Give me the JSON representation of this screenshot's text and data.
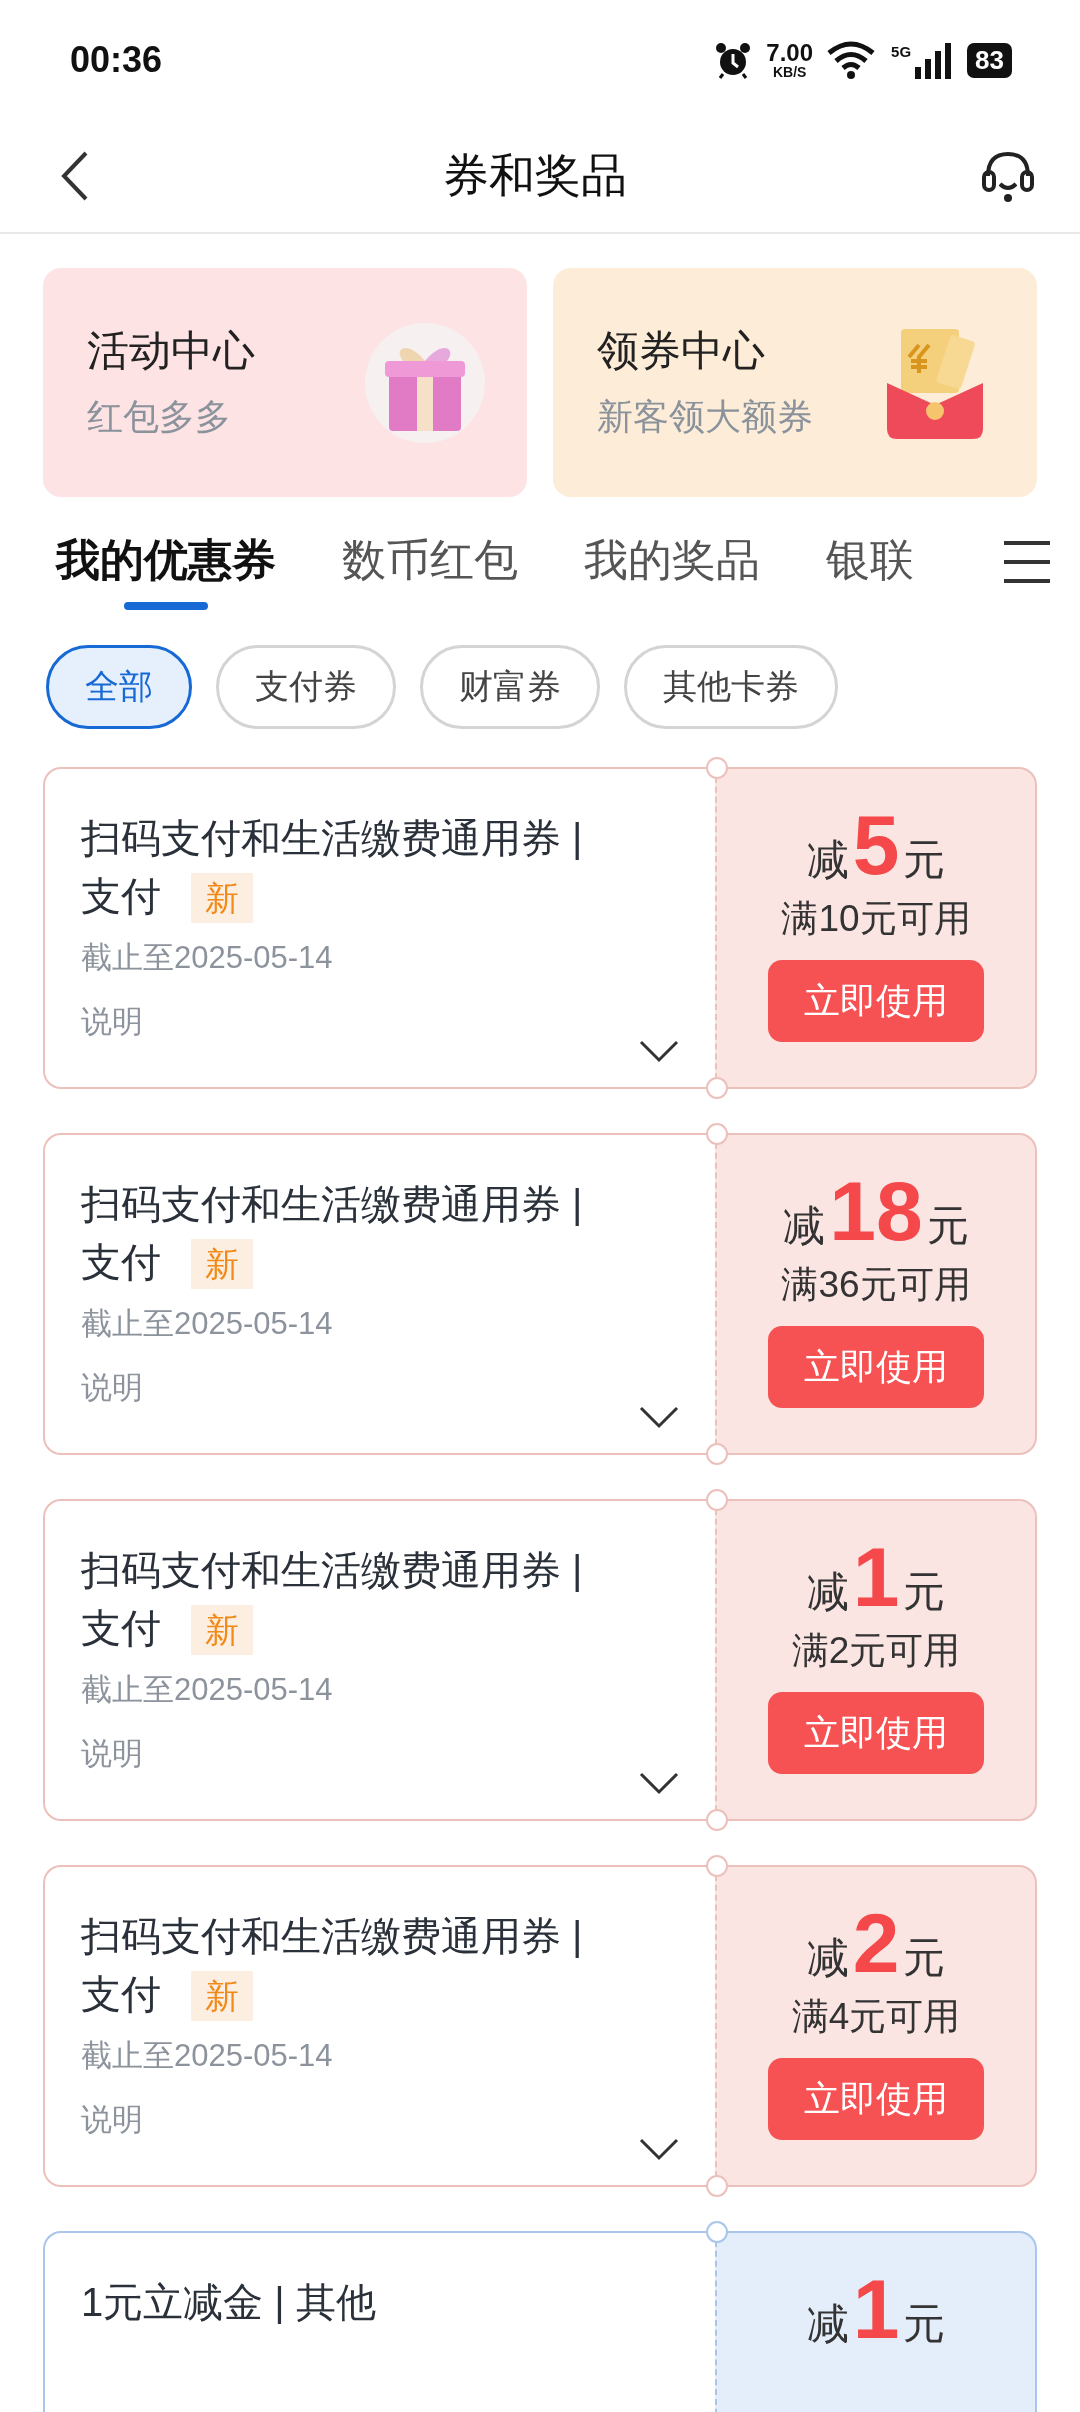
{
  "status_bar": {
    "time": "00:36",
    "speed": "7.00",
    "speed_unit": "KB/S",
    "network": "5G",
    "battery": "83"
  },
  "header": {
    "title": "券和奖品"
  },
  "promo_cards": [
    {
      "kind": "gift",
      "title": "活动中心",
      "subtitle": "红包多多"
    },
    {
      "kind": "envelope",
      "title": "领券中心",
      "subtitle": "新客领大额券"
    }
  ],
  "tabs": [
    {
      "label": "我的优惠券",
      "selected": true
    },
    {
      "label": "数币红包",
      "selected": false
    },
    {
      "label": "我的奖品",
      "selected": false
    },
    {
      "label": "银联",
      "selected": false
    }
  ],
  "filters": [
    {
      "label": "全部",
      "selected": true
    },
    {
      "label": "支付券",
      "selected": false
    },
    {
      "label": "财富券",
      "selected": false
    },
    {
      "label": "其他卡券",
      "selected": false
    }
  ],
  "coupons": [
    {
      "kind": "payment",
      "title": "扫码支付和生活缴费通用券 | 支付",
      "badge": "新",
      "deadline": "截止至2025-05-14",
      "note": "说明",
      "prefix": "减",
      "amount": "5",
      "unit": "元",
      "condition": "满10元可用",
      "action": "立即使用"
    },
    {
      "kind": "payment",
      "title": "扫码支付和生活缴费通用券 | 支付",
      "badge": "新",
      "deadline": "截止至2025-05-14",
      "note": "说明",
      "prefix": "减",
      "amount": "18",
      "unit": "元",
      "condition": "满36元可用",
      "action": "立即使用"
    },
    {
      "kind": "payment",
      "title": "扫码支付和生活缴费通用券 | 支付",
      "badge": "新",
      "deadline": "截止至2025-05-14",
      "note": "说明",
      "prefix": "减",
      "amount": "1",
      "unit": "元",
      "condition": "满2元可用",
      "action": "立即使用"
    },
    {
      "kind": "payment",
      "title": "扫码支付和生活缴费通用券 | 支付",
      "badge": "新",
      "deadline": "截止至2025-05-14",
      "note": "说明",
      "prefix": "减",
      "amount": "2",
      "unit": "元",
      "condition": "满4元可用",
      "action": "立即使用"
    },
    {
      "kind": "other",
      "title": "1元立减金 | 其他",
      "prefix": "减",
      "amount": "1",
      "unit": "元"
    }
  ]
}
